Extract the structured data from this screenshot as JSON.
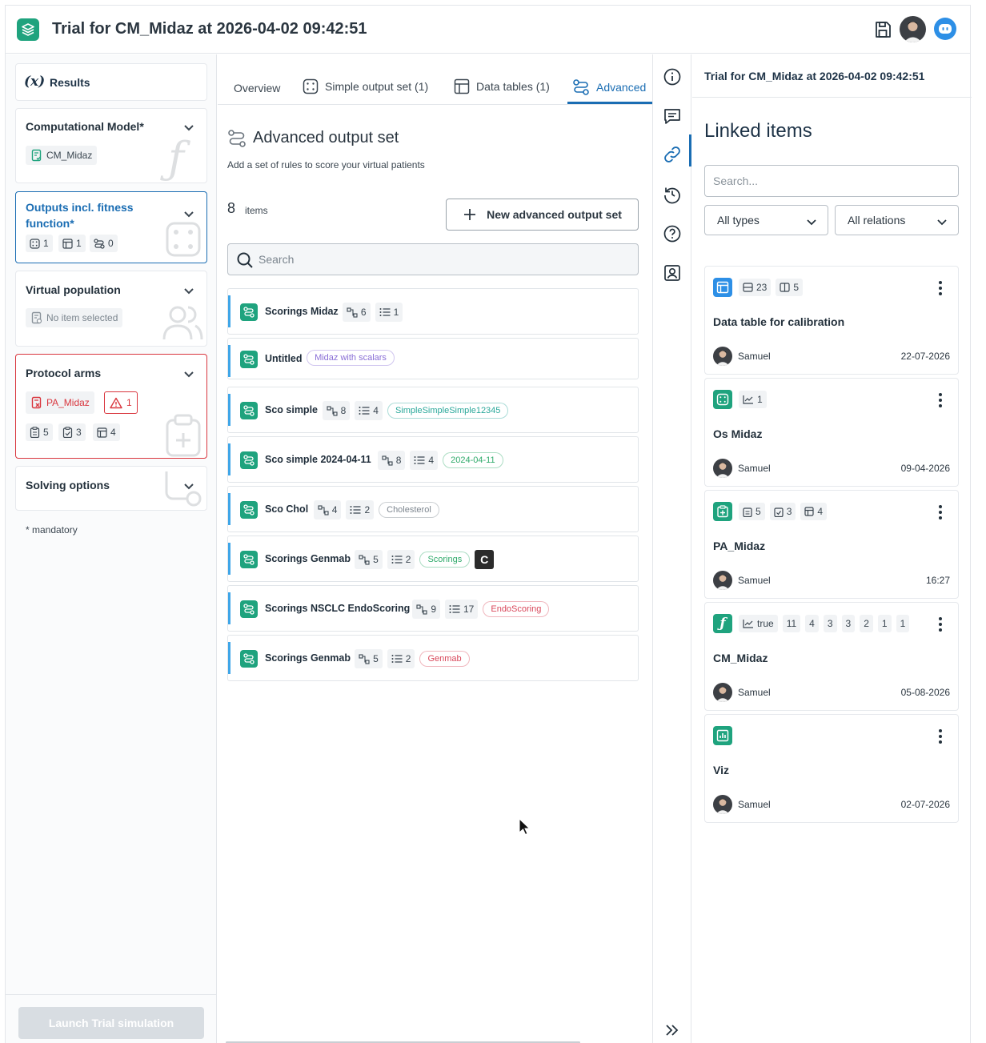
{
  "header": {
    "title": "Trial for CM_Midaz at 2026-04-02 09:42:51"
  },
  "sidebar": {
    "results_label": "Results",
    "results_icon_text": "(x)",
    "computational_model": {
      "title": "Computational Model*",
      "value": "CM_Midaz"
    },
    "outputs": {
      "title": "Outputs incl. fitness function*",
      "counts": [
        "1",
        "1",
        "0"
      ]
    },
    "virtual_population": {
      "title": "Virtual population",
      "value": "No item selected"
    },
    "protocol_arms": {
      "title": "Protocol arms",
      "value": "PA_Midaz",
      "warning_count": "1",
      "counts": [
        "5",
        "3",
        "4"
      ]
    },
    "solving_options": {
      "title": "Solving options"
    },
    "mandatory_note": "* mandatory",
    "launch_label": "Launch Trial simulation"
  },
  "tabs": [
    {
      "label": "Overview"
    },
    {
      "label": "Simple output set (1)"
    },
    {
      "label": "Data tables (1)"
    },
    {
      "label": "Advanced"
    }
  ],
  "main": {
    "title": "Advanced output set",
    "subtitle": "Add a set of rules to score your virtual patients",
    "count": "8",
    "count_label": "items",
    "new_button": "New advanced output set",
    "search_placeholder": "Search",
    "rows": [
      {
        "name": "Scorings Midaz",
        "rules": "6",
        "items": "1",
        "tag": ""
      },
      {
        "name": "Untitled",
        "rules": "",
        "items": "",
        "tag": "Midaz with scalars"
      },
      {
        "name": "Sco simple",
        "rules": "8",
        "items": "4",
        "tag": "SimpleSimpleSimple12345"
      },
      {
        "name": "Sco simple 2024-04-11",
        "rules": "8",
        "items": "4",
        "tag": "2024-04-11"
      },
      {
        "name": "Sco Chol",
        "rules": "4",
        "items": "2",
        "tag": "Cholesterol"
      },
      {
        "name": "Scorings Genmab",
        "rules": "5",
        "items": "2",
        "tag": "Scorings",
        "key": "C"
      },
      {
        "name": "Scorings NSCLC EndoScoring",
        "rules": "9",
        "items": "17",
        "tag": "EndoScoring"
      },
      {
        "name": "Scorings Genmab",
        "rules": "5",
        "items": "2",
        "tag": "Genmab"
      }
    ],
    "tag_colors": {
      "Midaz with scalars": "#8a6fd6",
      "SimpleSimpleSimple12345": "#2aa89a",
      "2024-04-11": "#2eaa6a",
      "Cholesterol": "#7d868f",
      "Scorings": "#2eaa6a",
      "EndoScoring": "#d9485b",
      "Genmab": "#d9485b"
    }
  },
  "right_panel": {
    "header_title": "Trial for CM_Midaz at 2026-04-02 09:42:51",
    "title": "Linked items",
    "search_placeholder": "Search...",
    "type_filter": "All types",
    "relation_filter": "All relations",
    "items": [
      {
        "name": "Data table for calibration",
        "user": "Samuel",
        "date": "22-07-2026",
        "badges": [
          "23",
          "5"
        ]
      },
      {
        "name": "Os Midaz",
        "user": "Samuel",
        "date": "09-04-2026",
        "badges": [
          "1"
        ]
      },
      {
        "name": "PA_Midaz",
        "user": "Samuel",
        "date": "16:27",
        "badges": [
          "5",
          "3",
          "4"
        ]
      },
      {
        "name": "CM_Midaz",
        "user": "Samuel",
        "date": "05-08-2026",
        "badges": [
          "true",
          "11",
          "4",
          "3",
          "3",
          "2",
          "1",
          "1"
        ]
      },
      {
        "name": "Viz",
        "user": "Samuel",
        "date": "02-07-2026",
        "badges": []
      }
    ]
  },
  "colors": {
    "brand": "#1fa37e",
    "accent": "#1a6db3",
    "danger": "#d9363e"
  }
}
